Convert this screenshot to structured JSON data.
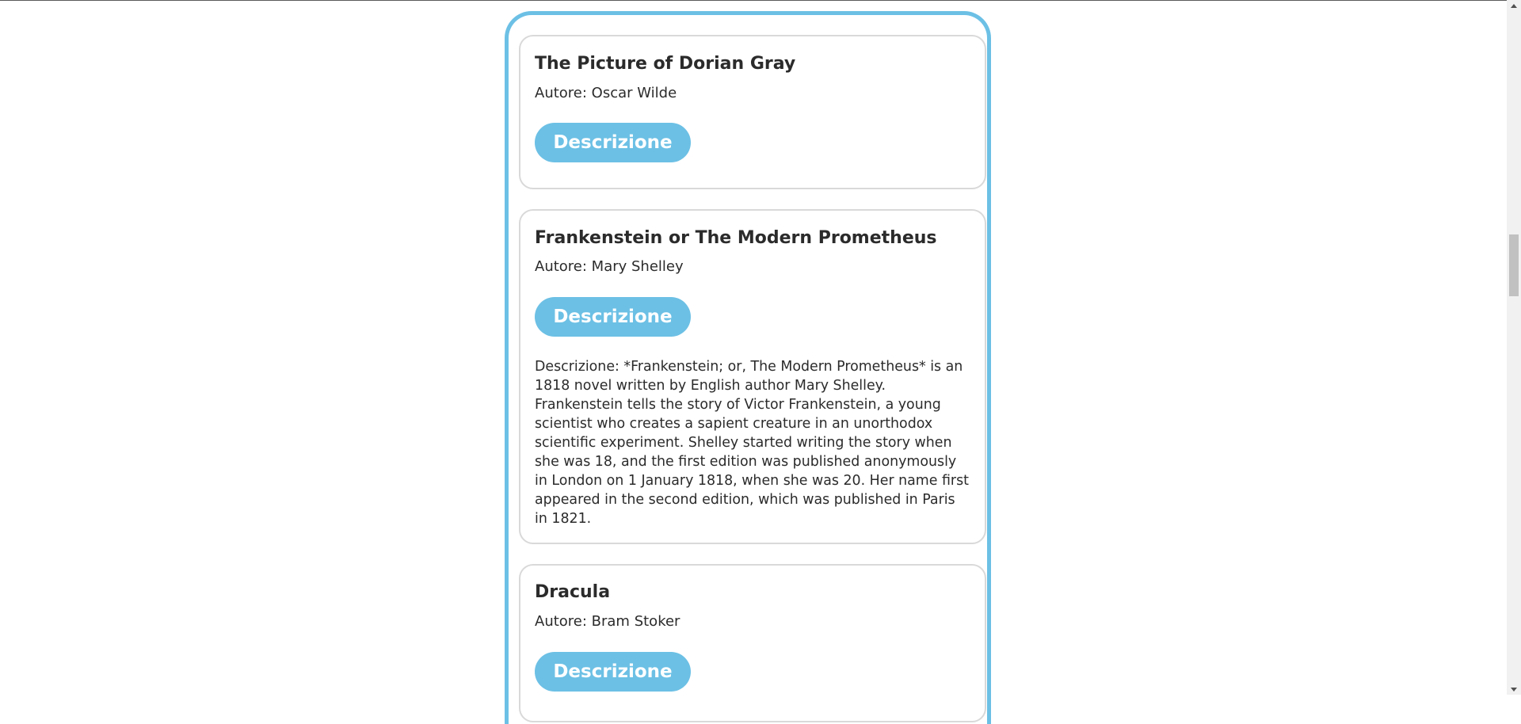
{
  "books": [
    {
      "title": "The Picture of Dorian Gray",
      "author": "Autore: Oscar Wilde",
      "button_label": "Descrizione",
      "description": ""
    },
    {
      "title": "Frankenstein or The Modern Prometheus",
      "author": "Autore: Mary Shelley",
      "button_label": "Descrizione",
      "description": "Descrizione: *Frankenstein; or, The Modern Prometheus* is an 1818 novel written by English author Mary Shelley. Frankenstein tells the story of Victor Frankenstein, a young scientist who creates a sapient creature in an unorthodox scientific experiment. Shelley started writing the story when she was 18, and the first edition was published anonymously in London on 1 January 1818, when she was 20. Her name first appeared in the second edition, which was published in Paris in 1821."
    },
    {
      "title": "Dracula",
      "author": "Autore: Bram Stoker",
      "button_label": "Descrizione",
      "description": ""
    }
  ],
  "colors": {
    "accent": "#6cc0e5",
    "card_border": "#d9d9d9",
    "text": "#2b2b2b"
  }
}
